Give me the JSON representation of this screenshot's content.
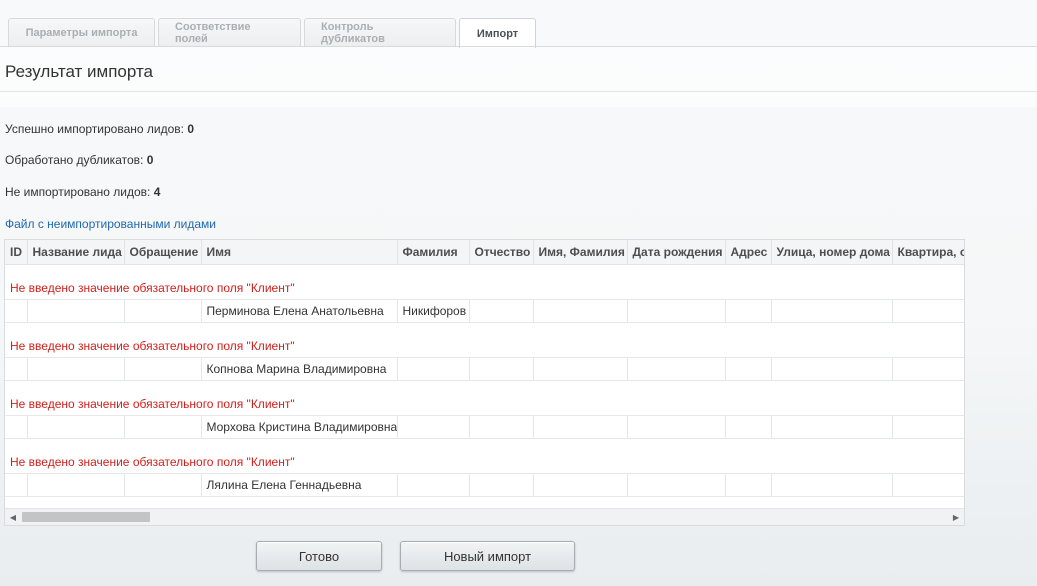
{
  "tabs": [
    {
      "label": "Параметры импорта",
      "active": false
    },
    {
      "label": "Соответствие полей",
      "active": false
    },
    {
      "label": "Контроль дубликатов",
      "active": false
    },
    {
      "label": "Импорт",
      "active": true
    }
  ],
  "page_title": "Результат импорта",
  "stats": {
    "imported_label": "Успешно импортировано лидов:",
    "imported_value": "0",
    "duplicates_label": "Обработано дубликатов:",
    "duplicates_value": "0",
    "not_imported_label": "Не импортировано лидов:",
    "not_imported_value": "4"
  },
  "file_link": "Файл с неимпортированными лидами",
  "table": {
    "columns": [
      "ID",
      "Название лида",
      "Обращение",
      "Имя",
      "Фамилия",
      "Отчество",
      "Имя, Фамилия",
      "Дата рождения",
      "Адрес",
      "Улица, номер дома",
      "Квартира, о"
    ],
    "error_text": "Не введено значение обязательного поля \"Клиент\"",
    "rows": [
      {
        "id": "",
        "lead_name": "",
        "salutation": "",
        "name": "Перминова Елена Анатольевна",
        "last_name": "Никифоров"
      },
      {
        "id": "",
        "lead_name": "",
        "salutation": "",
        "name": "Копнова Марина Владимировна",
        "last_name": ""
      },
      {
        "id": "",
        "lead_name": "",
        "salutation": "",
        "name": "Морхова Кристина Владимировна",
        "last_name": ""
      },
      {
        "id": "",
        "lead_name": "",
        "salutation": "",
        "name": "Лялина Елена Геннадьевна",
        "last_name": ""
      }
    ]
  },
  "buttons": {
    "done": "Готово",
    "new_import": "Новый импорт"
  }
}
